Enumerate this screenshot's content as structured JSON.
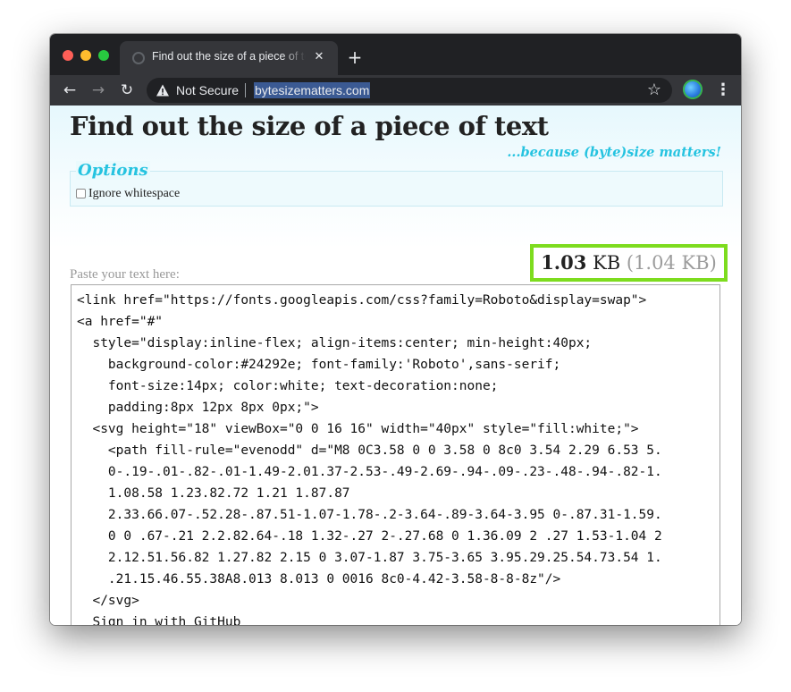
{
  "browser": {
    "tab_title": "Find out the size of a piece of text",
    "tab_close_icon": "close-icon",
    "new_tab_label": "+",
    "security_label": "Not Secure",
    "url": "bytesizematters.com",
    "bookmark_icon": "star-icon"
  },
  "page": {
    "headline": "Find out the size of a piece of text",
    "tagline": "...because (byte)size matters!",
    "options": {
      "legend": "Options",
      "ignore_whitespace_label": "Ignore whitespace",
      "ignore_whitespace_checked": false
    },
    "size": {
      "value": "1.03",
      "unit": "KB",
      "alt": "(1.04 KB)"
    },
    "paste_label": "Paste your text here:",
    "text_content": "<link href=\"https://fonts.googleapis.com/css?family=Roboto&display=swap\">\n<a href=\"#\"\n  style=\"display:inline-flex; align-items:center; min-height:40px;\n    background-color:#24292e; font-family:'Roboto',sans-serif;\n    font-size:14px; color:white; text-decoration:none;\n    padding:8px 12px 8px 0px;\">\n  <svg height=\"18\" viewBox=\"0 0 16 16\" width=\"40px\" style=\"fill:white;\">\n    <path fill-rule=\"evenodd\" d=\"M8 0C3.58 0 0 3.58 0 8c0 3.54 2.29 6.53 5.\n    0-.19-.01-.82-.01-1.49-2.01.37-2.53-.49-2.69-.94-.09-.23-.48-.94-.82-1.\n    1.08.58 1.23.82.72 1.21 1.87.87\n    2.33.66.07-.52.28-.87.51-1.07-1.78-.2-3.64-.89-3.64-3.95 0-.87.31-1.59.\n    0 0 .67-.21 2.2.82.64-.18 1.32-.27 2-.27.68 0 1.36.09 2 .27 1.53-1.04 2\n    2.12.51.56.82 1.27.82 2.15 0 3.07-1.87 3.75-3.65 3.95.29.25.54.73.54 1.\n    .21.15.46.55.38A8.013 8.013 0 0016 8c0-4.42-3.58-8-8-8z\"/>\n  </svg>\n  Sign in with GitHub\n</a>"
  },
  "colors": {
    "highlight_border": "#7ddc1e",
    "accent": "#25c3e0"
  }
}
